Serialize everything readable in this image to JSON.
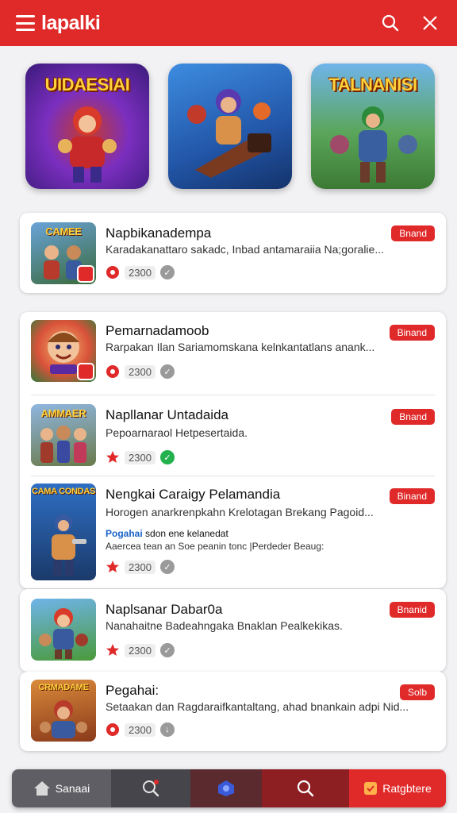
{
  "header": {
    "brand": "lapalki",
    "icons": [
      "menu-icon",
      "search-icon",
      "close-icon"
    ]
  },
  "featured": [
    {
      "title": "UIDAESIAI",
      "bg": "#6a2bbf"
    },
    {
      "title": "",
      "bg": "#2f6fc4"
    },
    {
      "title": "TALNANISI",
      "bg": "#3a9a4a"
    }
  ],
  "items": [
    {
      "thumb": "CAMEE",
      "title": "Napbikanadempa",
      "desc": "Karadakanattaro sakadc, Inbad antamaraiia Na;goralie...",
      "count": "2300",
      "button": "Bnand",
      "verified": false
    },
    {
      "thumb": "",
      "title": "Pemarnadamoob",
      "desc": "Rarpakan Ilan Sariamomskana kelnkantatlans anank...",
      "count": "2300",
      "button": "Binand",
      "verified": false
    },
    {
      "thumb": "AMMAER",
      "title": "Napllanar Untadaida",
      "desc": "Pepoarnaraol Hetpesertaida.",
      "count": "2300",
      "button": "Bnand",
      "verified": true
    },
    {
      "thumb": "CAMA CONDAS",
      "title": "Nengkai Caraigy Pelamandia",
      "desc": "Horogen anarkrenpkahn Krelotagan Brekang Pagoid...",
      "extra_label": "Pogahai",
      "extra_text": "sdon ene kelanedat",
      "extra2": "Aaercea tean an Soe peanin tonc |Perdeder Beaug:",
      "count": "2300",
      "button": "Binand",
      "verified": false
    },
    {
      "thumb": "",
      "title": "Naplsanar Dabar0a",
      "desc": "Nanahaitne Badeahngaka Bnaklan Pealkekikas.",
      "count": "2300",
      "button": "Bnanid",
      "verified": false
    },
    {
      "thumb": "CRMADAME",
      "title": "Pegahai:",
      "desc": "Setaakan dan Ragdaraifkantaltang, ahad bnankain adpi Nid...",
      "count": "2300",
      "button": "Solb",
      "verified": false
    }
  ],
  "bottom_nav": [
    {
      "label": "Sanaai",
      "icon": "home-icon"
    },
    {
      "label": "",
      "icon": "search-icon"
    },
    {
      "label": "",
      "icon": "gamepad-icon"
    },
    {
      "label": "",
      "icon": "explore-icon"
    },
    {
      "label": "Ratgbtere",
      "icon": "favorite-icon"
    }
  ],
  "colors": {
    "accent": "#e02a2a"
  }
}
